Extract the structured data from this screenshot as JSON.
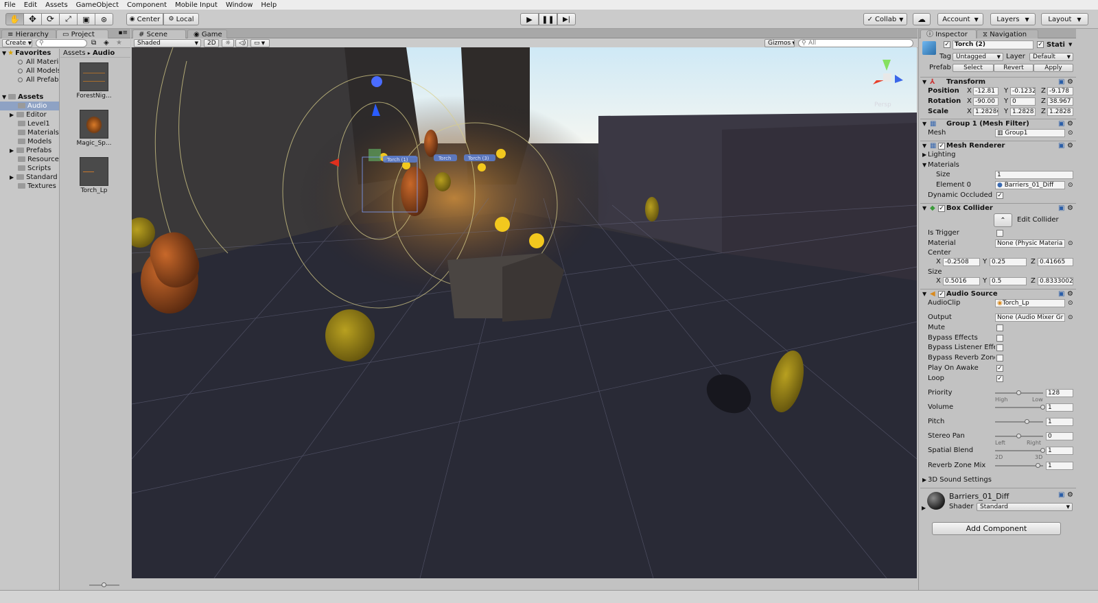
{
  "menu": [
    "File",
    "Edit",
    "Assets",
    "GameObject",
    "Component",
    "Mobile Input",
    "Window",
    "Help"
  ],
  "toolbar": {
    "tools": [
      "hand-tool-icon",
      "move-tool-icon",
      "rotate-tool-icon",
      "scale-tool-icon",
      "rect-tool-icon",
      "transform-tool-icon"
    ],
    "center": "Center",
    "local": "Local",
    "collab": "Collab",
    "account": "Account",
    "layers": "Layers",
    "layout": "Layout"
  },
  "left": {
    "tabs": {
      "hierarchy": "Hierarchy",
      "project": "Project"
    },
    "create": "Create",
    "favorites": {
      "title": "Favorites",
      "items": [
        "All Materia",
        "All Models",
        "All Prefabs"
      ]
    },
    "assets": {
      "title": "Assets",
      "items": [
        "Audio",
        "Editor",
        "Level1",
        "Materials",
        "Models",
        "Prefabs",
        "Resources",
        "Scripts",
        "Standard A",
        "Textures"
      ]
    },
    "breadcrumb": {
      "root": "Assets",
      "sep": "▸",
      "leaf": "Audio"
    },
    "files": [
      "ForestNig...",
      "Magic_Sp...",
      "Torch_Lp"
    ]
  },
  "scene": {
    "tabs": {
      "scene": "Scene",
      "game": "Game"
    },
    "shading": "Shaded",
    "mode2d": "2D",
    "gizmos": "Gizmos",
    "search": "All",
    "persp": "Persp",
    "labels": [
      "Torch (1)",
      "Torch",
      "Torch (3)"
    ]
  },
  "inspector": {
    "tabs": {
      "inspector": "Inspector",
      "navigation": "Navigation"
    },
    "name": "Torch (2)",
    "static": "Stati",
    "tag_label": "Tag",
    "tag": "Untagged",
    "layer_label": "Layer",
    "layer": "Default",
    "prefab_label": "Prefab",
    "prefab_buttons": {
      "select": "Select",
      "revert": "Revert",
      "apply": "Apply"
    },
    "transform": {
      "title": "Transform",
      "position": {
        "label": "Position",
        "x": "-12.81",
        "y": "-0.1232",
        "z": "-9.178"
      },
      "rotation": {
        "label": "Rotation",
        "x": "-90.00",
        "y": "0",
        "z": "38.967"
      },
      "scale": {
        "label": "Scale",
        "x": "1.28286",
        "y": "1.2828",
        "z": "1.2828"
      }
    },
    "mesh_filter": {
      "title": "Group 1 (Mesh Filter)",
      "mesh_label": "Mesh",
      "mesh": "Group1"
    },
    "mesh_renderer": {
      "title": "Mesh Renderer",
      "lighting": "Lighting",
      "materials": "Materials",
      "size_label": "Size",
      "size": "1",
      "element_label": "Element 0",
      "element": "Barriers_01_Diff",
      "dyn_label": "Dynamic Occluded",
      "dyn": true
    },
    "box_collider": {
      "title": "Box Collider",
      "edit": "Edit Collider",
      "trigger_label": "Is Trigger",
      "trigger": false,
      "material_label": "Material",
      "material": "None (Physic Materia",
      "center_label": "Center",
      "center": {
        "x": "-0.2508",
        "y": "0.25",
        "z": "0.41665"
      },
      "size_label": "Size",
      "size": {
        "x": "0.5016",
        "y": "0.5",
        "z": "0.8333002"
      }
    },
    "audio_source": {
      "title": "Audio Source",
      "clip_label": "AudioClip",
      "clip": "Torch_Lp",
      "output_label": "Output",
      "output": "None (Audio Mixer Gr",
      "mute": {
        "label": "Mute",
        "value": false
      },
      "bypass_effects": {
        "label": "Bypass Effects",
        "value": false
      },
      "bypass_listener": {
        "label": "Bypass Listener Effe",
        "value": false
      },
      "bypass_reverb": {
        "label": "Bypass Reverb Zone",
        "value": false
      },
      "play_on_awake": {
        "label": "Play On Awake",
        "value": true
      },
      "loop": {
        "label": "Loop",
        "value": true
      },
      "priority": {
        "label": "Priority",
        "value": "128",
        "level": 0.5,
        "low_hint": "High",
        "high_hint": "Low"
      },
      "volume": {
        "label": "Volume",
        "value": "1",
        "level": 1.0
      },
      "pitch": {
        "label": "Pitch",
        "value": "1",
        "level": 0.67
      },
      "stereo_pan": {
        "label": "Stereo Pan",
        "value": "0",
        "level": 0.5,
        "low_hint": "Left",
        "high_hint": "Right"
      },
      "spatial_blend": {
        "label": "Spatial Blend",
        "value": "1",
        "level": 1.0,
        "low_hint": "2D",
        "high_hint": "3D"
      },
      "reverb_mix": {
        "label": "Reverb Zone Mix",
        "value": "1",
        "level": 0.9
      },
      "sound_settings": "3D Sound Settings"
    },
    "material": {
      "name": "Barriers_01_Diff",
      "shader_label": "Shader",
      "shader": "Standard"
    },
    "add_component": "Add Component"
  }
}
